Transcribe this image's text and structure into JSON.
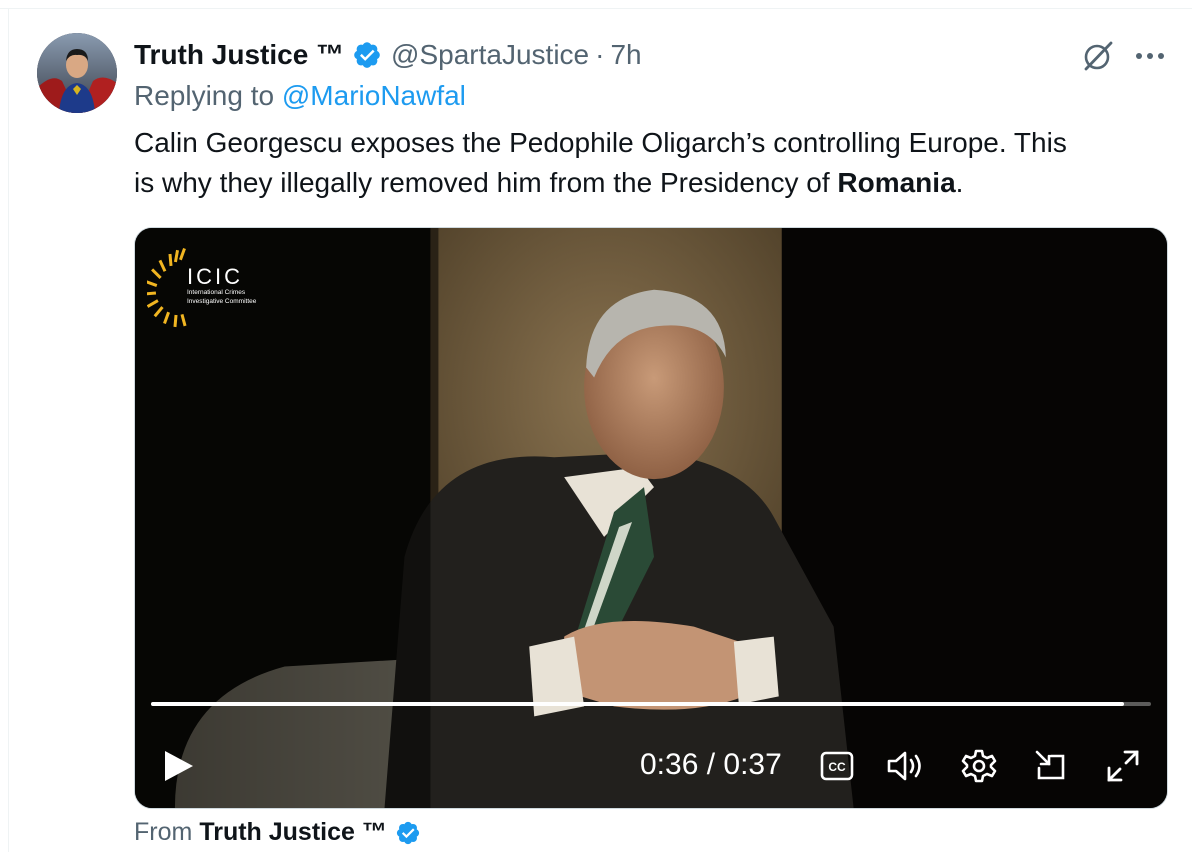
{
  "tweet": {
    "display_name": "Truth Justice ™",
    "handle": "@SpartaJustice",
    "separator": "·",
    "time": "7h",
    "replying_prefix": "Replying to ",
    "replying_to": "@MarioNawfal",
    "text_line1": "Calin Georgescu exposes the Pedophile Oligarch’s controlling Europe. This",
    "text_line2_before": "is why they illegally removed him from the Presidency of ",
    "text_line2_bold": "Romania",
    "text_line2_after": "."
  },
  "video": {
    "logo_text": "ICIC",
    "logo_sub1": "International Crimes",
    "logo_sub2": "Investigative Committee",
    "current_time": "0:36",
    "time_separator": " / ",
    "duration": "0:37",
    "progress": 0.973,
    "cc_label": "CC"
  },
  "source": {
    "from_label": "From",
    "from_name": "Truth Justice ™"
  },
  "colors": {
    "accent_blue": "#1d9bf0",
    "secondary_text": "#536471",
    "primary_text": "#0f1419",
    "logo_gold": "#f1b521"
  },
  "icons": {
    "grok": "grok-slash-circle-icon",
    "more": "more-horizontal-icon",
    "verified": "verified-badge-icon",
    "play": "play-icon",
    "captions": "closed-captions-icon",
    "volume": "volume-icon",
    "settings": "gear-icon",
    "pip": "picture-in-picture-icon",
    "fullscreen": "fullscreen-icon"
  }
}
